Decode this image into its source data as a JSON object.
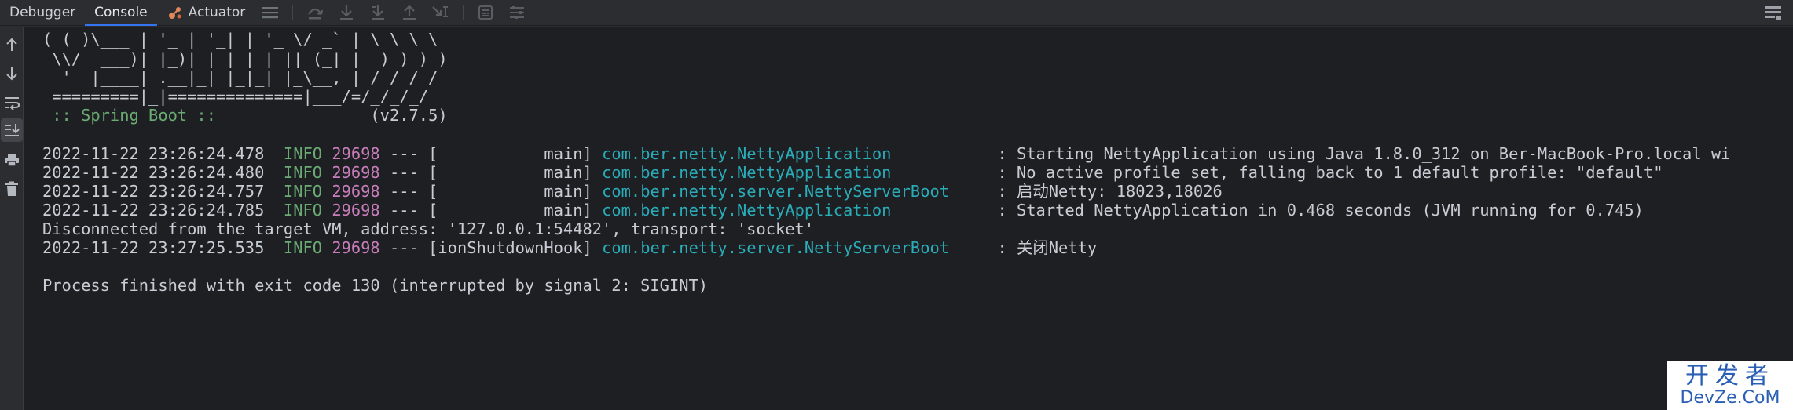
{
  "tabs": [
    {
      "label": "Debugger",
      "active": false
    },
    {
      "label": "Console",
      "active": true
    },
    {
      "label": "Actuator",
      "active": false,
      "icon": "actuator-icon"
    }
  ],
  "toolbar_icons": [
    "menu-icon",
    "step-over-icon",
    "step-into-icon",
    "force-step-into-icon",
    "step-out-icon",
    "run-to-cursor-icon",
    "evaluate-icon",
    "trace-icon"
  ],
  "side_toolbar_icons": [
    "scroll-up-icon",
    "scroll-down-icon",
    "soft-wrap-icon",
    "scroll-to-end-icon",
    "print-icon",
    "clear-icon"
  ],
  "console": {
    "banner": [
      "( ( )\\___ | '_ | '_| | '_ \\/ _` | \\ \\ \\ \\",
      " \\\\/  ___)| |_)| | | | | || (_| |  ) ) ) )",
      "  '  |____| .__|_| |_|_| |_\\__, | / / / /",
      " =========|_|==============|___/=/_/_/_/"
    ],
    "spring_label": " :: Spring Boot :: ",
    "spring_version": "(v2.7.5)",
    "log": [
      {
        "ts": "2022-11-22 23:26:24.478",
        "level": "INFO",
        "pid": "29698",
        "sep": "---",
        "thread": "[           main]",
        "logger": "com.ber.netty.NettyApplication",
        "msg": ": Starting NettyApplication using Java 1.8.0_312 on Ber-MacBook-Pro.local wi"
      },
      {
        "ts": "2022-11-22 23:26:24.480",
        "level": "INFO",
        "pid": "29698",
        "sep": "---",
        "thread": "[           main]",
        "logger": "com.ber.netty.NettyApplication",
        "msg": ": No active profile set, falling back to 1 default profile: \"default\""
      },
      {
        "ts": "2022-11-22 23:26:24.757",
        "level": "INFO",
        "pid": "29698",
        "sep": "---",
        "thread": "[           main]",
        "logger": "com.ber.netty.server.NettyServerBoot",
        "msg": ": 启动Netty: 18023,18026"
      },
      {
        "ts": "2022-11-22 23:26:24.785",
        "level": "INFO",
        "pid": "29698",
        "sep": "---",
        "thread": "[           main]",
        "logger": "com.ber.netty.NettyApplication",
        "msg": ": Started NettyApplication in 0.468 seconds (JVM running for 0.745)"
      }
    ],
    "disconnected": "Disconnected from the target VM, address: '127.0.0.1:54482', transport: 'socket'",
    "shutdown": {
      "ts": "2022-11-22 23:27:25.535",
      "level": "INFO",
      "pid": "29698",
      "sep": "---",
      "thread": "[ionShutdownHook]",
      "logger": "com.ber.netty.server.NettyServerBoot",
      "msg": ": 关闭Netty"
    },
    "finished": "Process finished with exit code 130 (interrupted by signal 2: SIGINT)"
  },
  "watermark": {
    "top": "开发者",
    "bottom": "DevZe.CoM"
  }
}
